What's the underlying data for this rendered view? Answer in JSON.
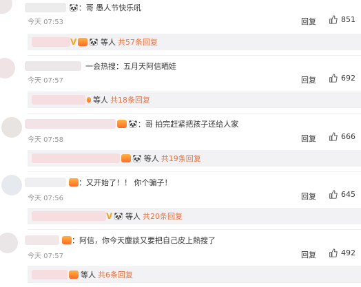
{
  "comments": [
    {
      "user_suffix": "：哥 愚人节快乐吼",
      "time": "今天 07:53",
      "reply_label": "回复",
      "likes": "851",
      "sub_summary": {
        "who": "等人",
        "link": "共57条回复"
      }
    },
    {
      "user_suffix": "一会热搜：五月天阿信晒娃",
      "time": "今天 07:57",
      "reply_label": "回复",
      "likes": "692",
      "sub_summary": {
        "who": "等人",
        "link": "共18条回复"
      }
    },
    {
      "user_suffix": "：哥 拍完赶紧把孩子还给人家",
      "time": "今天 07:58",
      "reply_label": "回复",
      "likes": "666",
      "sub_summary": {
        "who": "等人",
        "link": "共19条回复"
      }
    },
    {
      "user_suffix": "：又开始了！！ 你个骗子！",
      "time": "今天 07:56",
      "reply_label": "回复",
      "likes": "645",
      "sub_summary": {
        "who": "等人",
        "link": "共20条回复"
      }
    },
    {
      "user_suffix": "：阿信，你今天塵談又要把自己皮上熱搜了",
      "time": "今天 07:57",
      "reply_label": "回复",
      "likes": "492",
      "sub_summary": {
        "who": "等人",
        "link": "共6条回复"
      }
    }
  ],
  "icons": {
    "like": "thumb-up-icon",
    "vip": "verified-v-icon",
    "crown": "member-crown-icon",
    "panda": "panda-emoji-icon"
  },
  "colors": {
    "link": "#eb7340",
    "time": "#939393",
    "sub_bg": "#f2f2f5",
    "verified": "#f5a623"
  }
}
